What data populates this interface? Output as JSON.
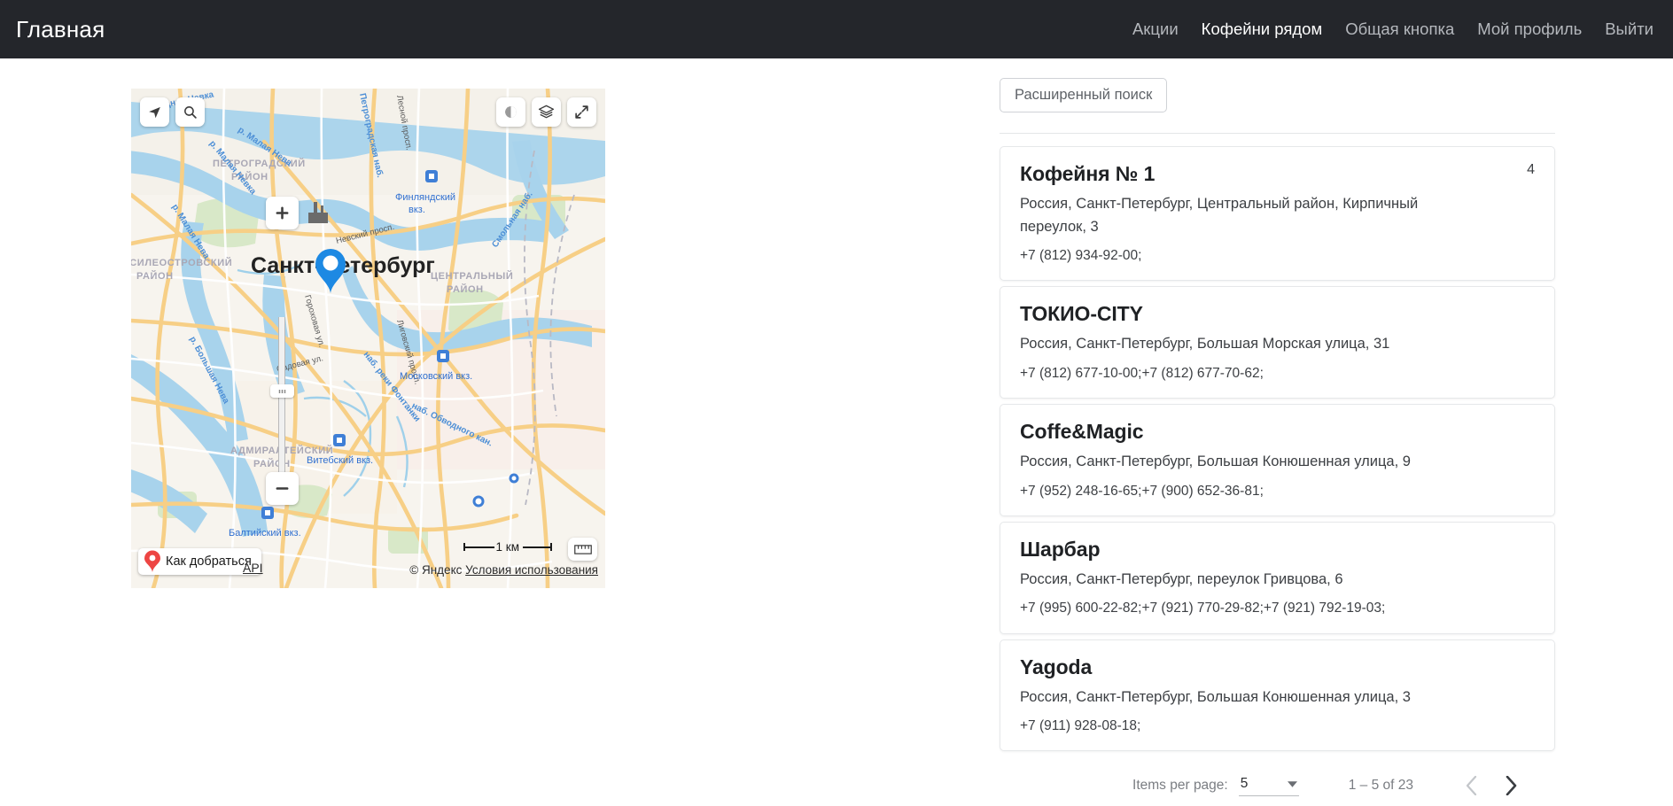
{
  "header": {
    "brand": "Главная",
    "nav": [
      {
        "label": "Акции",
        "active": false
      },
      {
        "label": "Кофейни рядом",
        "active": true
      },
      {
        "label": "Общая кнопка",
        "active": false
      },
      {
        "label": "Мой профиль",
        "active": false
      },
      {
        "label": "Выйти",
        "active": false
      }
    ]
  },
  "map": {
    "provider_copyright": "© Яндекс",
    "terms_link": "Условия использования",
    "api_link": "API",
    "route_button": "Как добраться",
    "scale_label": "1 км",
    "city_label": "Санкт-Петербург",
    "district_labels": [
      "ПЕТРОГРАДСКИЙ РАЙОН",
      "ЦЕНТРАЛЬНЫЙ РАЙОН",
      "АДМИРАЛТЕЙСКИЙ РАЙОН",
      "ВАСИЛЕОСТРОВСКИЙ РАЙОН"
    ],
    "station_labels": [
      "Финляндский вкз.",
      "Московский вкз.",
      "Витебский вкз.",
      "Балтийский вкз."
    ],
    "water_labels": [
      "р. Малая Невка",
      "р. Малая Нева",
      "р. Большая Нева",
      "Средняя Невка",
      "наб. реки Фонтанки",
      "наб. Обводного канала"
    ],
    "street_labels": [
      "Невский просп.",
      "Садовая ул.",
      "Гороховая ул.",
      "Лиговский просп.",
      "Лесной просп.",
      "Петроградская наб."
    ],
    "controls": [
      "geolocation-icon",
      "search-icon",
      "theme-toggle-icon",
      "layers-icon",
      "fullscreen-icon",
      "zoom-in-icon",
      "zoom-out-icon",
      "ruler-icon"
    ]
  },
  "search": {
    "advanced_button": "Расширенный поиск"
  },
  "results": {
    "items": [
      {
        "name": "Кофейня № 1",
        "address": "Россия, Санкт-Петербург, Центральный район, Кирпичный переулок, 3",
        "phones": "+7 (812) 934-92-00;",
        "badge": "4"
      },
      {
        "name": "ТОКИО-CITY",
        "address": "Россия, Санкт-Петербург, Большая Морская улица, 31",
        "phones": "+7 (812) 677-10-00;+7 (812) 677-70-62;",
        "badge": ""
      },
      {
        "name": "Coffe&Magic",
        "address": "Россия, Санкт-Петербург, Большая Конюшенная улица, 9",
        "phones": "+7 (952) 248-16-65;+7 (900) 652-36-81;",
        "badge": ""
      },
      {
        "name": "Шарбар",
        "address": "Россия, Санкт-Петербург, переулок Гривцова, 6",
        "phones": "+7 (995) 600-22-82;+7 (921) 770-29-82;+7 (921) 792-19-03;",
        "badge": ""
      },
      {
        "name": "Yagoda",
        "address": "Россия, Санкт-Петербург, Большая Конюшенная улица, 3",
        "phones": "+7 (911) 928-08-18;",
        "badge": ""
      }
    ]
  },
  "paginator": {
    "items_per_page_label": "Items per page:",
    "items_per_page_value": "5",
    "range_label": "1 – 5 of 23",
    "prev_enabled": false,
    "next_enabled": true
  },
  "colors": {
    "header_bg": "#24262b",
    "accent_nav_active": "#ffffff",
    "nav_inactive": "#b5b8bd",
    "card_border": "#e6e8ea",
    "pin_blue": "#1d89e3",
    "pin_red": "#ed4543"
  }
}
